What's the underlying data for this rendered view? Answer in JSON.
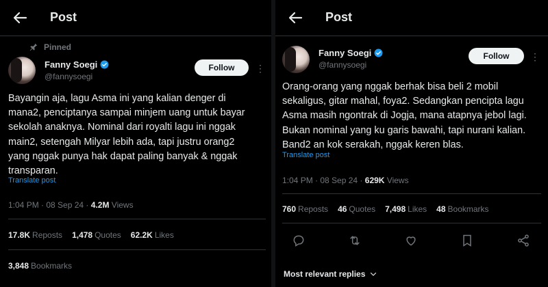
{
  "header": {
    "back_icon": "arrow-left-icon",
    "title": "Post"
  },
  "left_post": {
    "pinned_label": "Pinned",
    "author": {
      "name": "Fanny Soegi",
      "handle": "@fannysoegi",
      "verified": true
    },
    "follow_label": "Follow",
    "text_lines": [
      "Bayangin aja, lagu Asma ini yang kalian denger di",
      "mana2, penciptanya sampai minjem uang untuk bayar",
      "sekolah anaknya. Nominal dari royalti lagu ini nggak",
      "main2, setengah Milyar lebih ada, tapi justru orang2",
      "yang nggak punya hak dapat paling banyak & nggak",
      "transparan."
    ],
    "translate_label": "Translate post",
    "time": "1:04 PM",
    "date": "08 Sep 24",
    "views_count": "4.2M",
    "views_label": "Views",
    "reposts_count": "17.8K",
    "reposts_label": "Reposts",
    "quotes_count": "1,478",
    "quotes_label": "Quotes",
    "likes_count": "62.2K",
    "likes_label": "Likes",
    "bookmarks_count": "3,848",
    "bookmarks_label": "Bookmarks"
  },
  "right_post": {
    "author": {
      "name": "Fanny Soegi",
      "handle": "@fannysoegi",
      "verified": true
    },
    "follow_label": "Follow",
    "text_lines": [
      "Orang-orang yang nggak berhak bisa beli 2 mobil",
      "sekaligus, gitar mahal, foya2. Sedangkan pencipta lagu",
      "Asma masih ngontrak di Jogja, mana atapnya jebol lagi.",
      "Bukan nominal yang ku garis bawahi, tapi nurani kalian.",
      "Band2 an kok serakah, nggak keren blas."
    ],
    "translate_label": "Translate post",
    "time": "1:04 PM",
    "date": "08 Sep 24",
    "views_count": "629K",
    "views_label": "Views",
    "reposts_count": "760",
    "reposts_label": "Reposts",
    "quotes_count": "46",
    "quotes_label": "Quotes",
    "likes_count": "7,498",
    "likes_label": "Likes",
    "bookmarks_count": "48",
    "bookmarks_label": "Bookmarks",
    "actions": [
      "reply-icon",
      "repost-icon",
      "like-icon",
      "bookmark-icon",
      "share-icon"
    ],
    "replies_sort_label": "Most relevant replies"
  },
  "colors": {
    "background": "#000000",
    "text": "#e7e9ea",
    "muted": "#71767b",
    "link": "#1d9bf0",
    "verified": "#1d9bf0",
    "divider": "#2f3336"
  }
}
